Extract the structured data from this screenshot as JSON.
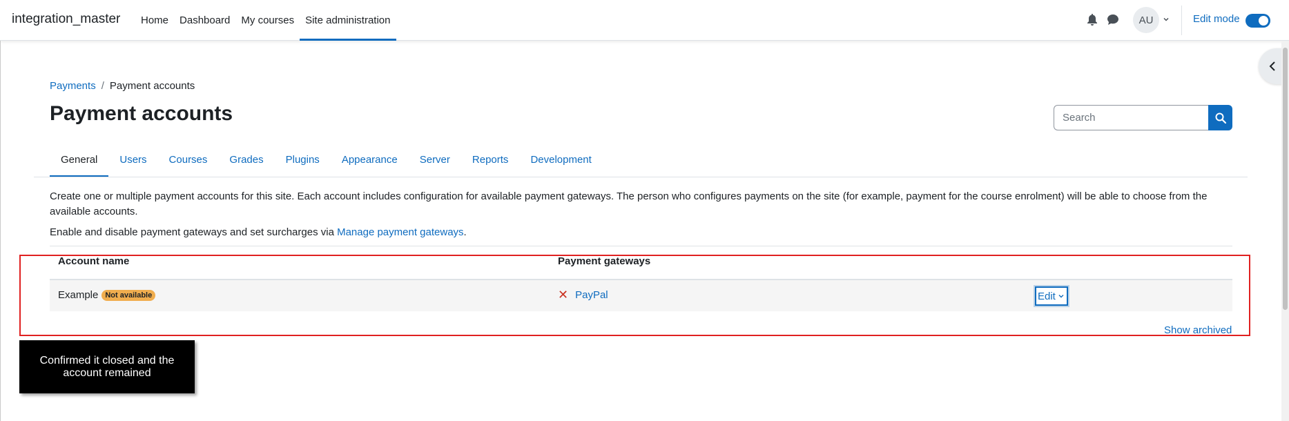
{
  "navbar": {
    "brand": "integration_master",
    "links": [
      {
        "label": "Home"
      },
      {
        "label": "Dashboard"
      },
      {
        "label": "My courses"
      },
      {
        "label": "Site administration",
        "active": true
      }
    ],
    "avatar_initials": "AU",
    "edit_mode_label": "Edit mode",
    "edit_mode_on": true
  },
  "breadcrumb": {
    "parent": "Payments",
    "separator": "/",
    "current": "Payment accounts"
  },
  "page_title": "Payment accounts",
  "search": {
    "placeholder": "Search"
  },
  "tabs": [
    {
      "label": "General",
      "active": true
    },
    {
      "label": "Users"
    },
    {
      "label": "Courses"
    },
    {
      "label": "Grades"
    },
    {
      "label": "Plugins"
    },
    {
      "label": "Appearance"
    },
    {
      "label": "Server"
    },
    {
      "label": "Reports"
    },
    {
      "label": "Development"
    }
  ],
  "description": {
    "paragraph1": "Create one or multiple payment accounts for this site. Each account includes configuration for available payment gateways. The person who configures payments on the site (for example, payment for the course enrolment) will be able to choose from the available accounts.",
    "paragraph2_prefix": "Enable and disable payment gateways and set surcharges via ",
    "paragraph2_link": "Manage payment gateways",
    "paragraph2_suffix": "."
  },
  "table": {
    "headers": {
      "account_name": "Account name",
      "payment_gateways": "Payment gateways"
    },
    "rows": [
      {
        "name": "Example",
        "badge": "Not available",
        "gateway": "PayPal",
        "gateway_enabled": false,
        "action": "Edit"
      }
    ],
    "show_archived": "Show archived"
  },
  "overlay": {
    "caption": "Confirmed it closed and the account remained",
    "highlight_color": "#e02020"
  },
  "colors": {
    "accent": "#0f6cbf",
    "badge": "#f0ad4e",
    "danger": "#ca3120"
  }
}
